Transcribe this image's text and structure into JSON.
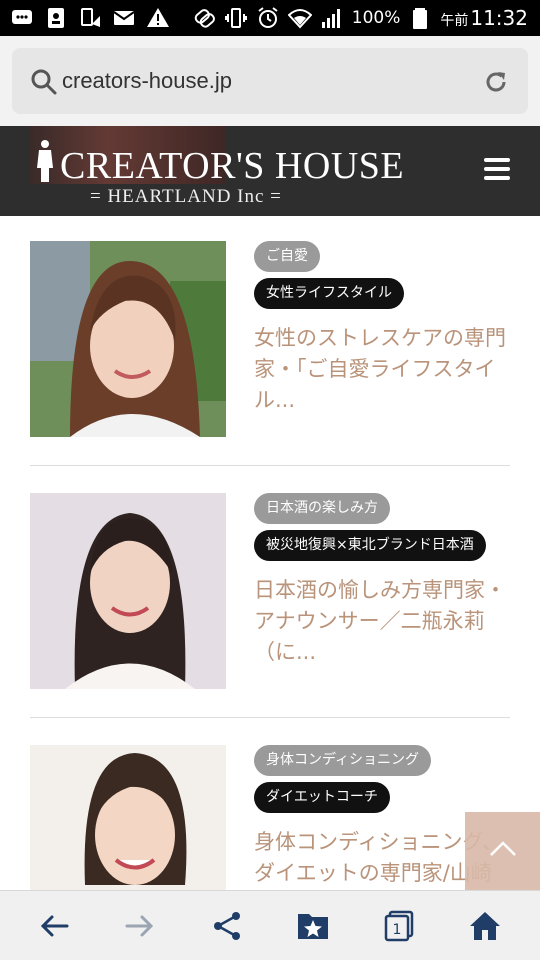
{
  "status_bar": {
    "battery": "100%",
    "time_prefix": "午前",
    "time": "11:32"
  },
  "browser": {
    "url": "creators-house.jp"
  },
  "site": {
    "logo_main": "CREATOR'S HOUSE",
    "logo_sub": "= HEARTLAND Inc ="
  },
  "articles": [
    {
      "tags": [
        "ご自愛",
        "女性ライフスタイル"
      ],
      "title": "女性のストレスケアの専門家・「ご自愛ライフスタイル..."
    },
    {
      "tags": [
        "日本酒の楽しみ方",
        "被災地復興×東北ブランド日本酒"
      ],
      "title": "日本酒の愉しみ方専門家・アナウンサー／二瓶永莉（に..."
    },
    {
      "tags": [
        "身体コンディショニング",
        "ダイエットコーチ"
      ],
      "title": "身体コンディショニング、ダイエットの専門家/山崎"
    }
  ],
  "colors": {
    "title_text": "#b9937a",
    "header_bg": "#2e2e2e",
    "tag_gray": "#9a9a9a",
    "tag_black": "#111111",
    "to_top_bg": "#d9b9a8",
    "toolbar_icon": "#1f3d66"
  },
  "icons": {
    "toolbar": [
      "back-arrow-icon",
      "forward-arrow-icon",
      "share-icon",
      "bookmark-star-icon",
      "tabs-icon",
      "home-icon"
    ]
  }
}
